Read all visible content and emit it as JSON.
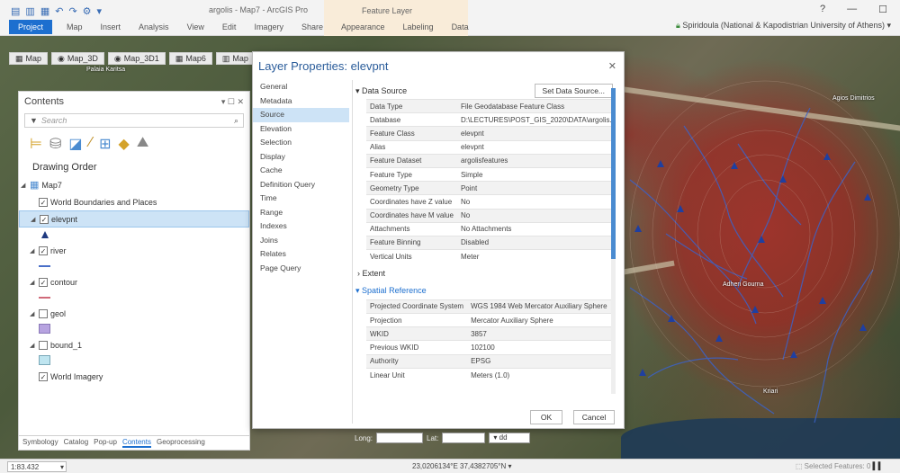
{
  "app": {
    "title": "argolis - Map7 - ArcGIS Pro",
    "context_title": "Feature Layer",
    "window_controls": [
      "?",
      "—",
      "☐"
    ],
    "user": "Spiridoula (National & Kapodistrian University of Athens)"
  },
  "ribbon_tabs": [
    "Project",
    "Map",
    "Insert",
    "Analysis",
    "View",
    "Edit",
    "Imagery",
    "Share",
    "Appearance",
    "Labeling",
    "Data"
  ],
  "view_tabs": [
    "Map",
    "Map_3D",
    "Map_3D1",
    "Map6",
    "Map"
  ],
  "map_labels": [
    "Palaia Karitsa",
    "Agios Dimitrios",
    "Adheri Gourna",
    "Kriari"
  ],
  "contents": {
    "title": "Contents",
    "controls": "▾ ☐ ✕",
    "search_placeholder": "Search",
    "drawing_order": "Drawing Order",
    "map_name": "Map7",
    "layers": [
      {
        "name": "World Boundaries and Places",
        "checked": "✓"
      },
      {
        "name": "elevpnt",
        "checked": "✓"
      },
      {
        "name": "river",
        "checked": "✓"
      },
      {
        "name": "contour",
        "checked": "✓"
      },
      {
        "name": "geol",
        "checked": ""
      },
      {
        "name": "bound_1",
        "checked": ""
      },
      {
        "name": "World Imagery",
        "checked": "✓"
      }
    ],
    "bottom_tabs": [
      "Symbology",
      "Catalog",
      "Pop-up",
      "Contents",
      "Geoprocessing"
    ]
  },
  "dialog": {
    "title": "Layer Properties: elevpnt",
    "nav": [
      "General",
      "Metadata",
      "Source",
      "Elevation",
      "Selection",
      "Display",
      "Cache",
      "Definition Query",
      "Time",
      "Range",
      "Indexes",
      "Joins",
      "Relates",
      "Page Query"
    ],
    "data_source_header": "Data Source",
    "set_data_source": "Set Data Source...",
    "data_source": [
      {
        "k": "Data Type",
        "v": "File Geodatabase Feature Class"
      },
      {
        "k": "Database",
        "v": "D:\\LECTURES\\POST_GIS_2020\\DATA\\argolis.gdb"
      },
      {
        "k": "Feature Class",
        "v": "elevpnt"
      },
      {
        "k": "Alias",
        "v": "elevpnt"
      },
      {
        "k": "Feature Dataset",
        "v": "argolisfeatures"
      },
      {
        "k": "Feature Type",
        "v": "Simple"
      },
      {
        "k": "Geometry Type",
        "v": "Point"
      },
      {
        "k": "Coordinates have Z value",
        "v": "No"
      },
      {
        "k": "Coordinates have M value",
        "v": "No"
      },
      {
        "k": "Attachments",
        "v": "No Attachments"
      },
      {
        "k": "Feature Binning",
        "v": "Disabled"
      },
      {
        "k": "Vertical Units",
        "v": "Meter"
      }
    ],
    "extent_header": "Extent",
    "spatial_ref_header": "Spatial Reference",
    "spatial_ref": [
      {
        "k": "Projected Coordinate System",
        "v": "WGS 1984 Web Mercator Auxiliary Sphere"
      },
      {
        "k": "Projection",
        "v": "Mercator Auxiliary Sphere"
      },
      {
        "k": "WKID",
        "v": "3857"
      },
      {
        "k": "Previous WKID",
        "v": "102100"
      },
      {
        "k": "Authority",
        "v": "EPSG"
      },
      {
        "k": "Linear Unit",
        "v": "Meters (1.0)"
      }
    ],
    "ok": "OK",
    "cancel": "Cancel"
  },
  "coord_bar": {
    "long": "Long:",
    "lat": "Lat:",
    "unit": "dd"
  },
  "status": {
    "scale": "1:83.432",
    "coordinates": "23,0206134°E 37,4382705°N",
    "selected": "Selected Features: 0"
  }
}
